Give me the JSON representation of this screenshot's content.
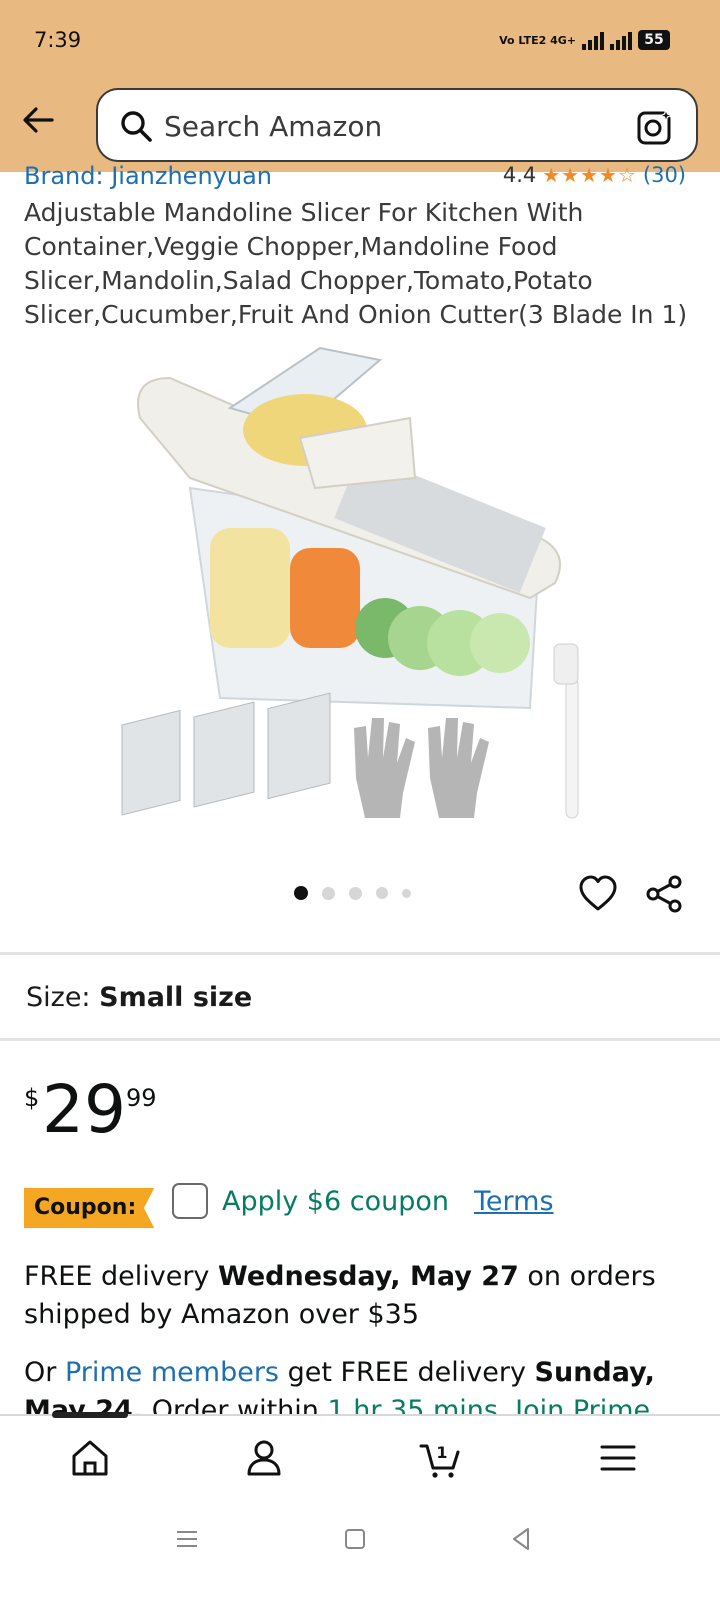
{
  "status_bar": {
    "time": "7:39",
    "network": "Vo LTE2 4G+",
    "battery": "55"
  },
  "search": {
    "placeholder": "Search Amazon",
    "icons": [
      "back-arrow-icon",
      "search-icon",
      "camera-lens-icon"
    ]
  },
  "product": {
    "brand": "Brand: Jianzhenyuan",
    "rating_value": "4.4",
    "rating_stars": "★★★★☆",
    "rating_count": "(30)",
    "title": "Adjustable Mandoline Slicer For Kitchen With Container,Veggie Chopper,Mandoline Food Slicer,Mandolin,Salad Chopper,Tomato,Potato Slicer,Cucumber,Fruit And Onion Cutter(3 Blade In 1)",
    "image_count": 5,
    "active_image_index": 0
  },
  "size": {
    "label": "Size:",
    "value": "Small size"
  },
  "price": {
    "currency": "$",
    "whole": "29",
    "fraction": "99"
  },
  "coupon": {
    "tag": "Coupon:",
    "text": "Apply $6 coupon",
    "terms": "Terms"
  },
  "delivery": {
    "prefix": "FREE delivery",
    "date": "Wednesday, May 27",
    "suffix": "on orders shipped by Amazon over $35"
  },
  "prime": {
    "prefix": "Or",
    "members_link": "Prime members",
    "middle": "get FREE delivery",
    "date": "Sunday, May 24.",
    "order_within": "Order within",
    "countdown": "1 hr 35 mins.",
    "join": "Join Prime"
  },
  "bottom_nav": {
    "items": [
      "home-icon",
      "account-icon",
      "cart-icon",
      "menu-icon"
    ],
    "cart_count": "1"
  },
  "colors": {
    "header": "#e9b982",
    "link": "#1e6fb0",
    "coupon_green": "#067d62",
    "coupon_tag": "#f5a623",
    "star": "#f08a24"
  }
}
